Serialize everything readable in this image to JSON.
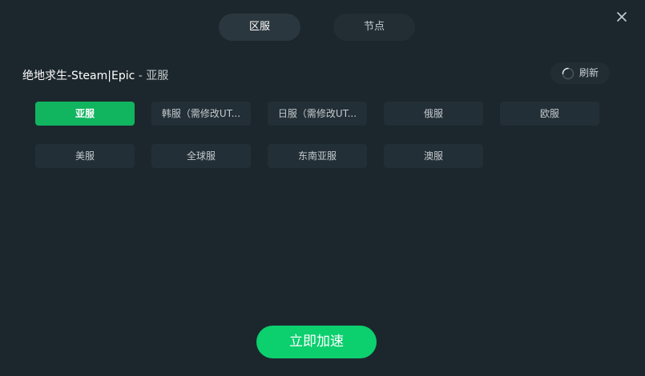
{
  "tabs": [
    {
      "label": "区服",
      "active": true
    },
    {
      "label": "节点",
      "active": false
    }
  ],
  "game": {
    "title": "绝地求生-Steam|Epic",
    "separator": " - ",
    "region": "亚服"
  },
  "refresh": {
    "label": "刷新",
    "icon": "spinner-icon"
  },
  "servers": [
    {
      "label": "亚服",
      "selected": true
    },
    {
      "label": "韩服（需修改UT...",
      "selected": false
    },
    {
      "label": "日服（需修改UT...",
      "selected": false
    },
    {
      "label": "俄服",
      "selected": false
    },
    {
      "label": "欧服",
      "selected": false
    },
    {
      "label": "美服",
      "selected": false
    },
    {
      "label": "全球服",
      "selected": false
    },
    {
      "label": "东南亚服",
      "selected": false
    },
    {
      "label": "澳服",
      "selected": false
    }
  ],
  "accelerate_button": {
    "label": "立即加速"
  },
  "colors": {
    "background": "#1c272d",
    "accent": "#0ccf6e",
    "selected": "#11b45f",
    "chip": "#232f36"
  }
}
